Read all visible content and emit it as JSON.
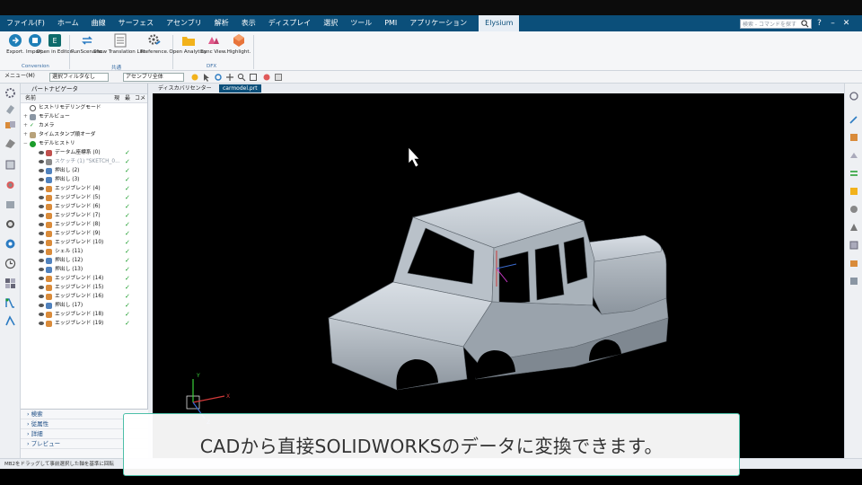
{
  "menubar": {
    "items": [
      "ファイル(F)",
      "ホーム",
      "曲線",
      "サーフェス",
      "アセンブリ",
      "解析",
      "表示",
      "ディスプレイ",
      "選択",
      "ツール",
      "PMI",
      "アプリケーション",
      "Elysium"
    ],
    "search_placeholder": "検索 - コマンドを探す"
  },
  "ribbon": {
    "groups": [
      {
        "label": "Conversion",
        "buttons": [
          "Export.",
          "Import.",
          "Open in Editor."
        ]
      },
      {
        "label": "共通",
        "buttons": [
          "RunScenario.",
          "Show Translation List.",
          "Preference."
        ]
      },
      {
        "label": "DFX",
        "buttons": [
          "Open Analytics.",
          "Sync View.",
          "Highlight."
        ]
      }
    ]
  },
  "toolbar": {
    "menu_label": "メニュー(M)",
    "filter_label": "選択フィルタなし",
    "scope_label": "アセンブリ全体"
  },
  "nav": {
    "title": "パートナビゲータ",
    "columns": [
      "名前",
      "現",
      "最",
      "コメ"
    ],
    "top_items": [
      "ヒストリモデリングモード",
      "モデルビュー",
      "カメラ",
      "タイムスタンプ順オーダ",
      "モデルヒストリ"
    ],
    "features": [
      {
        "label": "データム座標系 (0)",
        "color": "#c0504d"
      },
      {
        "label": "スケッチ (1) \"SKETCH_0...",
        "color": "#8a8a8a"
      },
      {
        "label": "押出し (2)",
        "color": "#4f81bd"
      },
      {
        "label": "押出し (3)",
        "color": "#4f81bd"
      },
      {
        "label": "エッジブレンド (4)",
        "color": "#d98b3a"
      },
      {
        "label": "エッジブレンド (5)",
        "color": "#d98b3a"
      },
      {
        "label": "エッジブレンド (6)",
        "color": "#d98b3a"
      },
      {
        "label": "エッジブレンド (7)",
        "color": "#d98b3a"
      },
      {
        "label": "エッジブレンド (8)",
        "color": "#d98b3a"
      },
      {
        "label": "エッジブレンド (9)",
        "color": "#d98b3a"
      },
      {
        "label": "エッジブレンド (10)",
        "color": "#d98b3a"
      },
      {
        "label": "シェル (11)",
        "color": "#d98b3a"
      },
      {
        "label": "押出し (12)",
        "color": "#4f81bd"
      },
      {
        "label": "押出し (13)",
        "color": "#4f81bd"
      },
      {
        "label": "エッジブレンド (14)",
        "color": "#d98b3a"
      },
      {
        "label": "エッジブレンド (15)",
        "color": "#d98b3a"
      },
      {
        "label": "エッジブレンド (16)",
        "color": "#d98b3a"
      },
      {
        "label": "押出し (17)",
        "color": "#4f81bd"
      },
      {
        "label": "エッジブレンド (18)",
        "color": "#d98b3a"
      },
      {
        "label": "エッジブレンド (19)",
        "color": "#d98b3a"
      }
    ],
    "sections": [
      "検索",
      "従属性",
      "詳細",
      "プレビュー"
    ]
  },
  "tabs": [
    "ディスカバリセンター",
    "carmodel.prt"
  ],
  "statusbar": {
    "text": "MB2をドラッグして事前選択した軸を基準に回転"
  },
  "caption": {
    "text": "CADから直接SOLIDWORKSのデータに変換できます。"
  },
  "colors": {
    "menubar": "#0b4f7a",
    "viewport": "#000000",
    "caption_border": "#4dbfa8",
    "check": "#1b9c2b"
  },
  "triad": {
    "x": "X",
    "y": "Y",
    "z": "Z"
  }
}
